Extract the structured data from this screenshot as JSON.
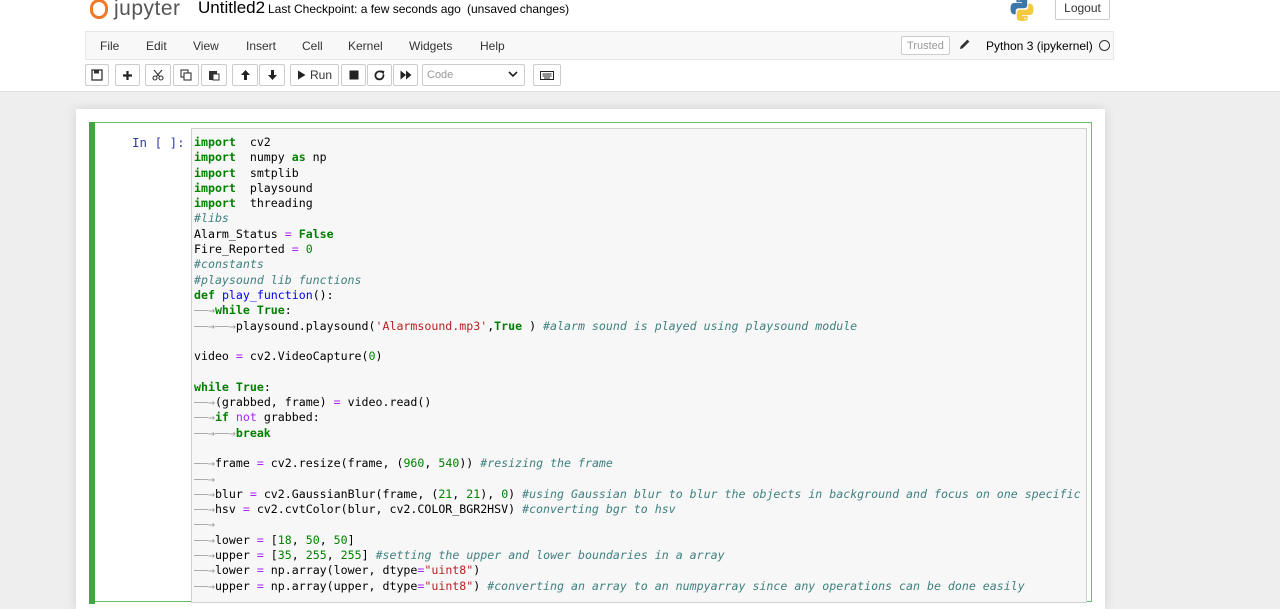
{
  "header": {
    "logo_text": "jupyter",
    "notebook_title": "Untitled2",
    "checkpoint": "Last Checkpoint: a few seconds ago",
    "autosave": "(unsaved changes)",
    "logout_label": "Logout"
  },
  "menubar": {
    "items": [
      "File",
      "Edit",
      "View",
      "Insert",
      "Cell",
      "Kernel",
      "Widgets",
      "Help"
    ],
    "trusted_label": "Trusted",
    "kernel_name": "Python 3 (ipykernel)"
  },
  "toolbar": {
    "run_label": "Run",
    "cell_type": "Code",
    "buttons": [
      "save-icon",
      "add-cell-icon",
      "cut-icon",
      "copy-icon",
      "paste-icon",
      "move-up-icon",
      "move-down-icon",
      "run-icon",
      "stop-icon",
      "restart-icon",
      "fast-forward-icon",
      "keyboard-icon"
    ]
  },
  "cell": {
    "prompt": "In [ ]:",
    "code_lines": [
      [
        [
          "kw",
          "import"
        ],
        [
          "",
          "  cv2"
        ]
      ],
      [
        [
          "kw",
          "import"
        ],
        [
          "",
          "  numpy "
        ],
        [
          "kw",
          "as"
        ],
        [
          "",
          " np"
        ]
      ],
      [
        [
          "kw",
          "import"
        ],
        [
          "",
          "  smtplib"
        ]
      ],
      [
        [
          "kw",
          "import"
        ],
        [
          "",
          "  playsound"
        ]
      ],
      [
        [
          "kw",
          "import"
        ],
        [
          "",
          "  threading"
        ]
      ],
      [
        [
          "cm",
          "#libs"
        ]
      ],
      [
        [
          "",
          "Alarm_Status "
        ],
        [
          "op",
          "="
        ],
        [
          "",
          " "
        ],
        [
          "kw",
          "False"
        ]
      ],
      [
        [
          "",
          "Fire_Reported "
        ],
        [
          "op",
          "="
        ],
        [
          "",
          " "
        ],
        [
          "num",
          "0"
        ]
      ],
      [
        [
          "cm",
          "#constants"
        ]
      ],
      [
        [
          "cm",
          "#playsound lib functions"
        ]
      ],
      [
        [
          "kw",
          "def"
        ],
        [
          "",
          " "
        ],
        [
          "fn",
          "play_function"
        ],
        [
          "",
          "():"
        ]
      ],
      [
        [
          "ar",
          "——→"
        ],
        [
          "kw",
          "while"
        ],
        [
          "",
          " "
        ],
        [
          "kw",
          "True"
        ],
        [
          "",
          ":"
        ]
      ],
      [
        [
          "ar",
          "——→——→"
        ],
        [
          "",
          "playsound.playsound("
        ],
        [
          "str",
          "'Alarmsound.mp3'"
        ],
        [
          "",
          ","
        ],
        [
          "kw",
          "True"
        ],
        [
          "",
          " ) "
        ],
        [
          "cm",
          "#alarm sound is played using playsound module"
        ]
      ],
      [],
      [
        [
          "",
          "video "
        ],
        [
          "op",
          "="
        ],
        [
          "",
          " cv2.VideoCapture("
        ],
        [
          "num",
          "0"
        ],
        [
          "",
          ")"
        ]
      ],
      [],
      [
        [
          "kw",
          "while"
        ],
        [
          "",
          " "
        ],
        [
          "kw",
          "True"
        ],
        [
          "",
          ":"
        ]
      ],
      [
        [
          "ar",
          "——→"
        ],
        [
          "",
          "(grabbed, frame) "
        ],
        [
          "op",
          "="
        ],
        [
          "",
          " video.read()"
        ]
      ],
      [
        [
          "ar",
          "——→"
        ],
        [
          "kw",
          "if"
        ],
        [
          "",
          " "
        ],
        [
          "op",
          "not"
        ],
        [
          "",
          " grabbed:"
        ]
      ],
      [
        [
          "ar",
          "——→——→"
        ],
        [
          "kw",
          "break"
        ]
      ],
      [],
      [
        [
          "ar",
          "——→"
        ],
        [
          "",
          "frame "
        ],
        [
          "op",
          "="
        ],
        [
          "",
          " cv2.resize(frame, ("
        ],
        [
          "num",
          "960"
        ],
        [
          "",
          ", "
        ],
        [
          "num",
          "540"
        ],
        [
          "",
          "))"
        ],
        [
          "",
          " "
        ],
        [
          "cm",
          "#resizing the frame"
        ]
      ],
      [
        [
          "ar",
          "——→"
        ]
      ],
      [
        [
          "ar",
          "——→"
        ],
        [
          "",
          "blur "
        ],
        [
          "op",
          "="
        ],
        [
          "",
          " cv2.GaussianBlur(frame, ("
        ],
        [
          "num",
          "21"
        ],
        [
          "",
          ", "
        ],
        [
          "num",
          "21"
        ],
        [
          "",
          "), "
        ],
        [
          "num",
          "0"
        ],
        [
          "",
          ") "
        ],
        [
          "cm",
          "#using Gaussian blur to blur the objects in background and focus on one specific"
        ]
      ],
      [
        [
          "ar",
          "——→"
        ],
        [
          "",
          "hsv "
        ],
        [
          "op",
          "="
        ],
        [
          "",
          " cv2.cvtColor(blur, cv2.COLOR_BGR2HSV) "
        ],
        [
          "cm",
          "#converting bgr to hsv"
        ]
      ],
      [
        [
          "ar",
          "——→"
        ]
      ],
      [
        [
          "ar",
          "——→"
        ],
        [
          "",
          "lower "
        ],
        [
          "op",
          "="
        ],
        [
          "",
          " ["
        ],
        [
          "num",
          "18"
        ],
        [
          "",
          ", "
        ],
        [
          "num",
          "50"
        ],
        [
          "",
          ", "
        ],
        [
          "num",
          "50"
        ],
        [
          "",
          "]"
        ]
      ],
      [
        [
          "ar",
          "——→"
        ],
        [
          "",
          "upper "
        ],
        [
          "op",
          "="
        ],
        [
          "",
          " ["
        ],
        [
          "num",
          "35"
        ],
        [
          "",
          ", "
        ],
        [
          "num",
          "255"
        ],
        [
          "",
          ", "
        ],
        [
          "num",
          "255"
        ],
        [
          "",
          "] "
        ],
        [
          "cm",
          "#setting the upper and lower boundaries in a array"
        ]
      ],
      [
        [
          "ar",
          "——→"
        ],
        [
          "",
          "lower "
        ],
        [
          "op",
          "="
        ],
        [
          "",
          " np.array(lower, dtype"
        ],
        [
          "op",
          "="
        ],
        [
          "str",
          "\"uint8\""
        ],
        [
          "",
          ")"
        ]
      ],
      [
        [
          "ar",
          "——→"
        ],
        [
          "",
          "upper "
        ],
        [
          "op",
          "="
        ],
        [
          "",
          " np.array(upper, dtype"
        ],
        [
          "op",
          "="
        ],
        [
          "str",
          "\"uint8\""
        ],
        [
          "",
          ") "
        ],
        [
          "cm",
          "#converting an array to an numpyarray since any operations can be done easily"
        ]
      ]
    ]
  },
  "colors": {
    "cell_border": "#66bb6a",
    "cell_bar": "#42a542",
    "keyword": "#008000",
    "prompt": "#303f9f"
  }
}
